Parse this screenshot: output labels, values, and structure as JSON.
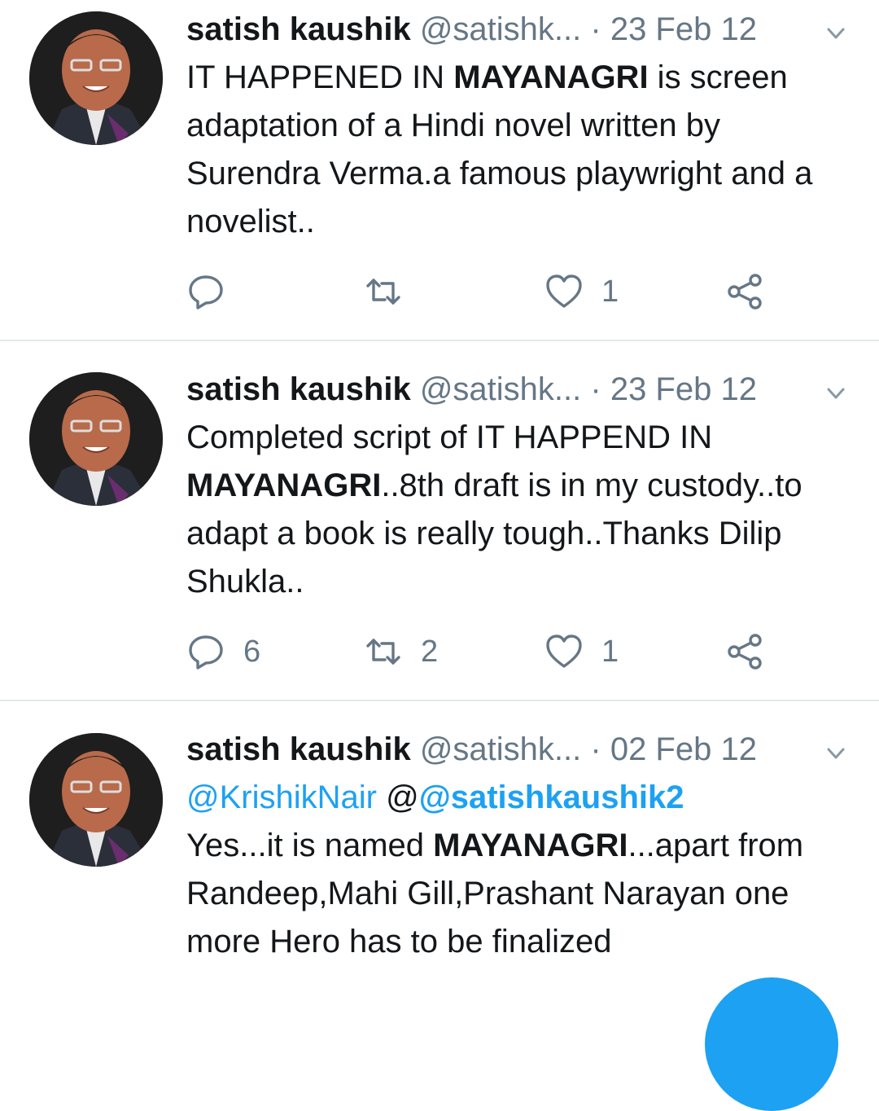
{
  "tweets": [
    {
      "name": "satish kaushik",
      "handle": "@satishk...",
      "sep": "·",
      "date": "23 Feb 12",
      "text_parts": [
        {
          "t": "IT HAPPENED IN "
        },
        {
          "t": "MAYANAGRI",
          "b": true
        },
        {
          "t": " is screen adaptation of a Hindi novel written by Surendra Verma.a famous playwright and a novelist.."
        }
      ],
      "reply_count": "",
      "retweet_count": "",
      "like_count": "1"
    },
    {
      "name": "satish kaushik",
      "handle": "@satishk...",
      "sep": "·",
      "date": "23 Feb 12",
      "text_parts": [
        {
          "t": "Completed script of IT HAPPEND IN "
        },
        {
          "t": "MAYANAGRI",
          "b": true
        },
        {
          "t": "..8th draft is in my custody..to adapt a book is really tough..Thanks Dilip Shukla.."
        }
      ],
      "reply_count": "6",
      "retweet_count": "2",
      "like_count": "1"
    },
    {
      "name": "satish kaushik",
      "handle": "@satishk...",
      "sep": "·",
      "date": "02 Feb 12",
      "mention_1": "@KrishikNair",
      "mention_at": "@",
      "mention_2": "@satishkaushik2",
      "text_parts": [
        {
          "t": "Yes...it is named "
        },
        {
          "t": "MAYANAGRI",
          "b": true
        },
        {
          "t": "...apart from Randeep,Mahi Gill,Prashant Narayan one more Hero has to be finalized"
        }
      ]
    }
  ],
  "icons": {
    "reply": "reply-icon",
    "retweet": "retweet-icon",
    "like": "heart-icon",
    "share": "share-icon",
    "caret": "chevron-down-icon"
  },
  "colors": {
    "text": "#14171a",
    "secondary": "#657786",
    "accent": "#1da1f2",
    "divider": "#e1e8ed"
  }
}
